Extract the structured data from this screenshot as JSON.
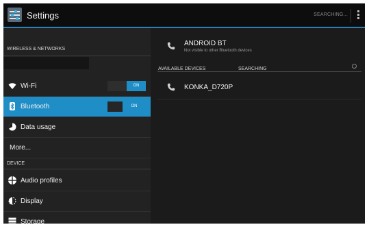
{
  "action_bar": {
    "title": "Settings",
    "action_label": "SEARCHING...",
    "overflow_icon": "overflow-menu-icon"
  },
  "left_pane": {
    "sections": [
      {
        "header": "WIRELESS & NETWORKS"
      },
      {
        "header": "DEVICE"
      }
    ],
    "items": [
      {
        "label": "Wi-Fi",
        "icon": "wifi-icon",
        "toggle": "ON",
        "selected": false
      },
      {
        "label": "Bluetooth",
        "icon": "bluetooth-icon",
        "toggle": "ON",
        "selected": true
      },
      {
        "label": "Data usage",
        "icon": "data-usage-icon"
      },
      {
        "label": "More..."
      },
      {
        "label": "Audio profiles",
        "icon": "audio-profiles-icon"
      },
      {
        "label": "Display",
        "icon": "display-icon"
      },
      {
        "label": "Storage",
        "icon": "storage-icon"
      }
    ]
  },
  "right_pane": {
    "device": {
      "name": "ANDROID BT",
      "status": "Not visible to other Bluetooth devices",
      "icon": "phone-icon"
    },
    "available_header": "AVAILABLE DEVICES",
    "searching_label": "SEARCHING",
    "devices": [
      {
        "name": "KONKA_D720P",
        "icon": "phone-icon"
      }
    ]
  },
  "colors": {
    "accent": "#1f8dc6",
    "background": "#1b1b1b",
    "action_bar": "#0d0d0d"
  }
}
